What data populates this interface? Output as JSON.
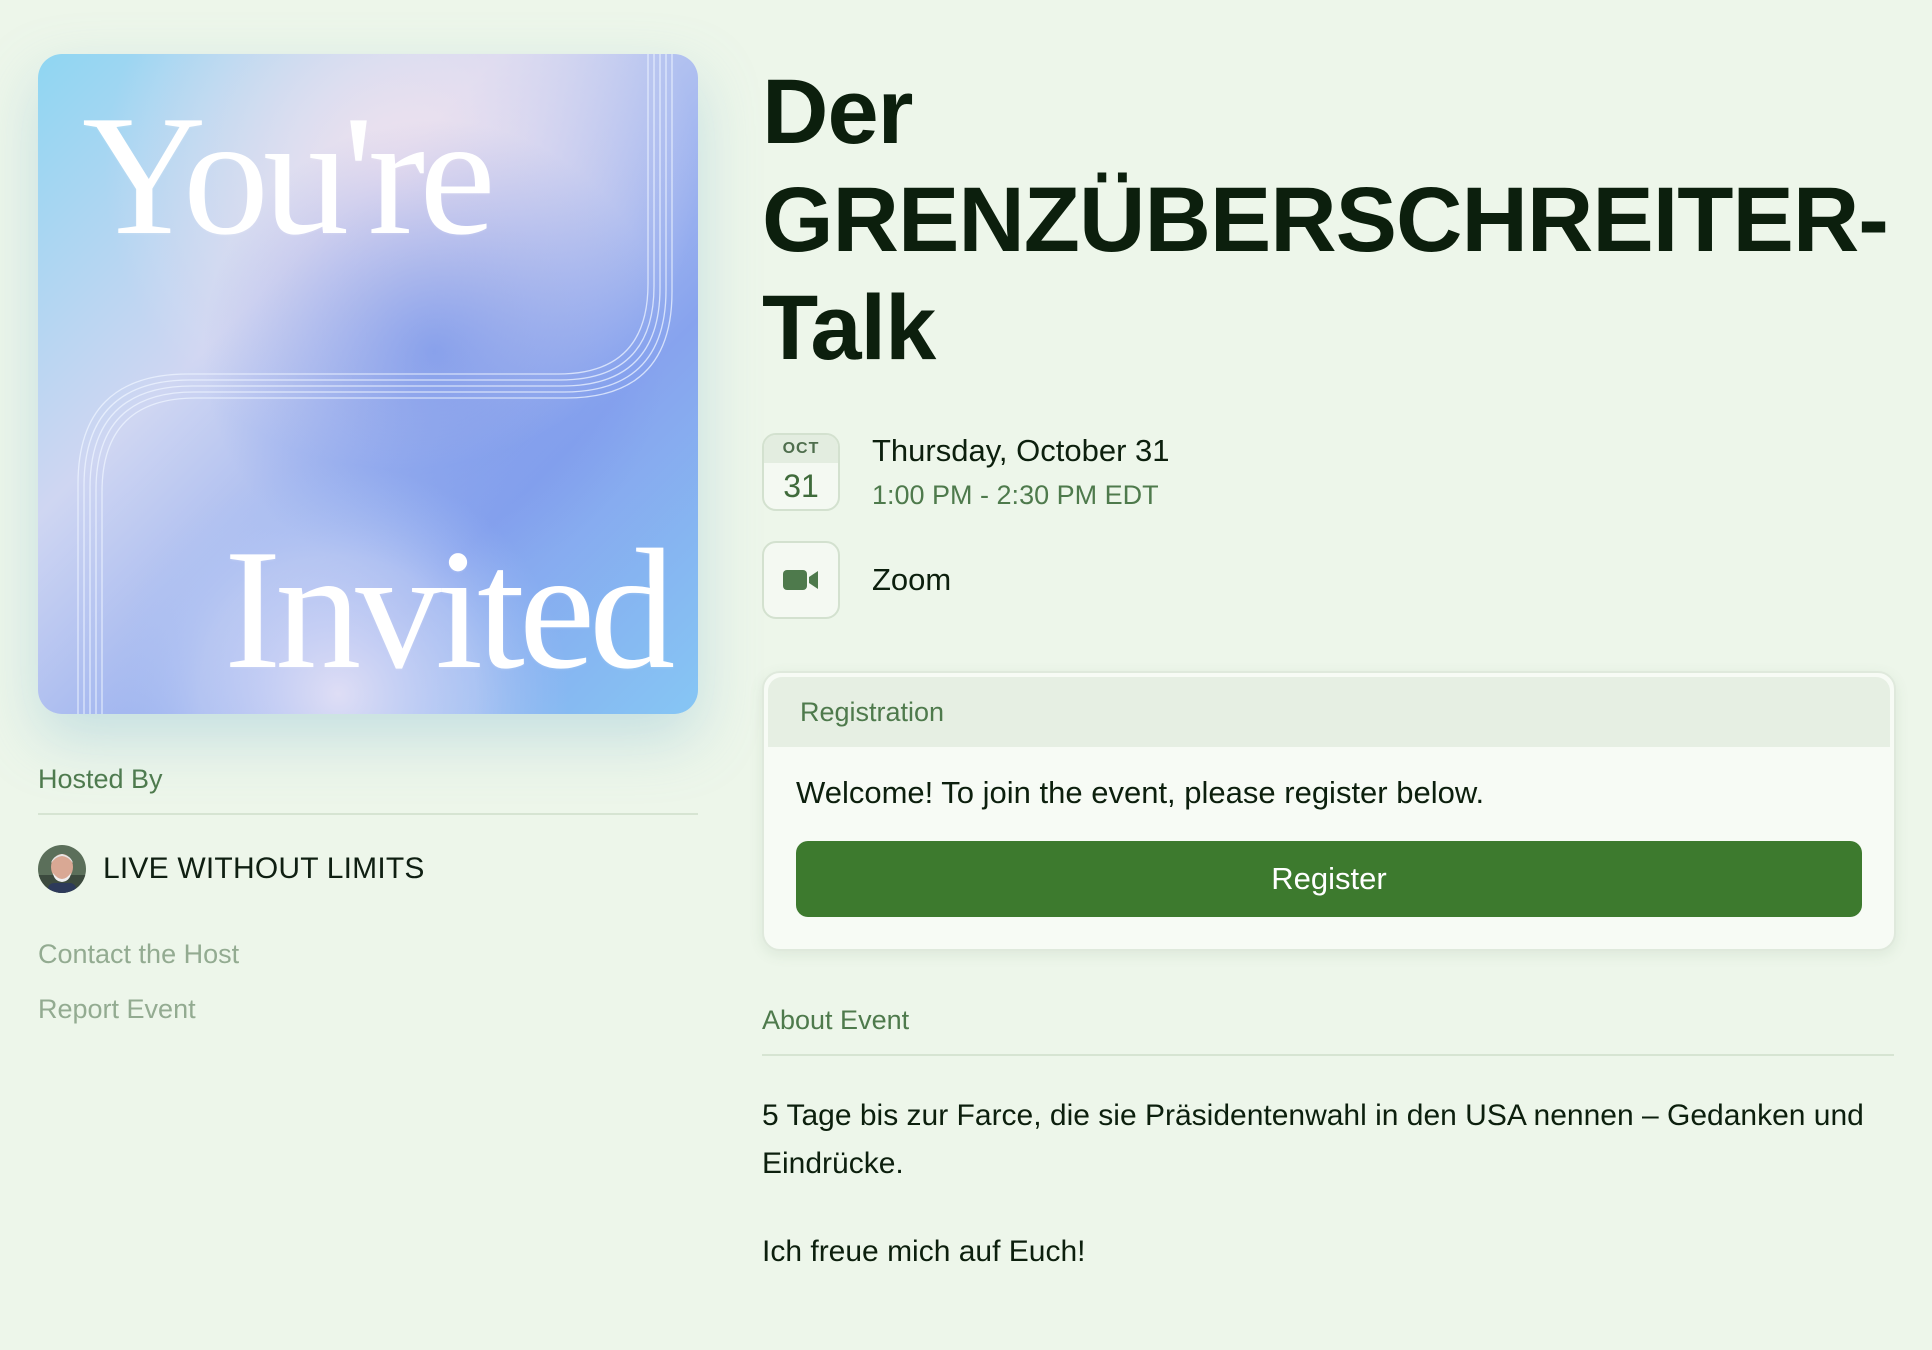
{
  "cover": {
    "word_top": "You're",
    "word_bottom": "Invited"
  },
  "host": {
    "section_label": "Hosted By",
    "name": "LIVE WITHOUT LIMITS",
    "contact_link": "Contact the Host",
    "report_link": "Report Event"
  },
  "event": {
    "title": "Der GRENZÜBERSCHREITER-Talk",
    "calendar_month": "OCT",
    "calendar_day": "31",
    "date": "Thursday, October 31",
    "time": "1:00 PM - 2:30 PM EDT",
    "location": "Zoom",
    "location_icon": "video-camera-icon"
  },
  "registration": {
    "header": "Registration",
    "message": "Welcome! To join the event, please register below.",
    "button_label": "Register"
  },
  "about": {
    "section_label": "About Event",
    "paragraph_1": "5 Tage bis zur Farce, die sie Präsidentenwahl in den USA nennen – Gedanken und Eindrücke.",
    "paragraph_2": "Ich freue mich auf Euch!"
  },
  "colors": {
    "page_background": "#edf6ea",
    "accent_green": "#3d7a2e",
    "muted_green": "#4e7a4c",
    "link_muted": "#93ab91"
  }
}
